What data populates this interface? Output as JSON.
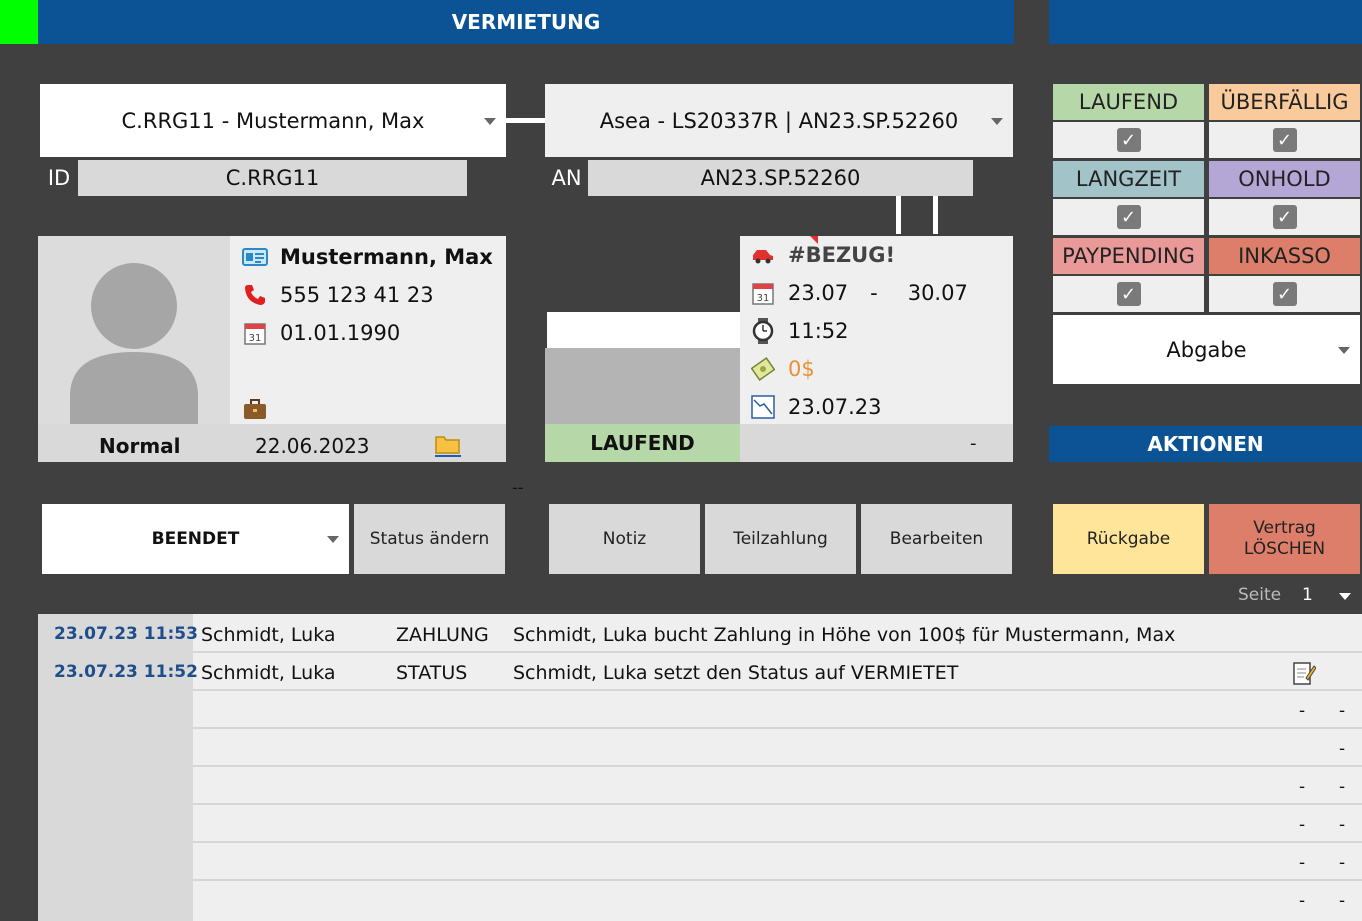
{
  "colors": {
    "header_blue": "#0b5394",
    "green_marker": "#00ff00",
    "laufend": "#b6d7a8",
    "ueberfaellig": "#f9cb9c",
    "langzeit": "#a2c4c9",
    "onhold": "#b4a7d6",
    "paypending": "#ea9999",
    "inkasso": "#dd7e6b",
    "rueckgabe": "#ffe599",
    "loeschen": "#dd7e6b",
    "price_orange": "#e69138"
  },
  "header": {
    "title": "VERMIETUNG"
  },
  "customer": {
    "dropdown": "C.RRG11 - Mustermann, Max",
    "id_label": "ID",
    "id_value": "C.RRG11",
    "name": "Mustermann, Max",
    "phone": "555 123 41 23",
    "birthdate": "01.01.1990",
    "tier": "Normal",
    "since": "22.06.2023",
    "icons": {
      "card": "id-card-icon",
      "phone": "phone-icon",
      "calendar": "calendar-icon",
      "bag": "briefcase-icon",
      "folder": "folder-icon"
    }
  },
  "asset": {
    "dropdown": "Asea - LS20337R | AN23.SP.52260",
    "an_label": "AN",
    "an_value": "AN23.SP.52260",
    "status_badge": "LAUFEND",
    "status_dash": "-",
    "bezug": "#BEZUG!",
    "date_from": "23.07",
    "date_sep": "-",
    "date_to": "30.07",
    "time": "11:52",
    "price": "0$",
    "created": "23.07.23",
    "mid_dash": "--"
  },
  "filters": [
    {
      "label": "LAUFEND",
      "color": "#b6d7a8",
      "checked": true
    },
    {
      "label": "ÜBERFÄLLIG",
      "color": "#f9cb9c",
      "checked": true
    },
    {
      "label": "LANGZEIT",
      "color": "#a2c4c9",
      "checked": true
    },
    {
      "label": "ONHOLD",
      "color": "#b4a7d6",
      "checked": true
    },
    {
      "label": "PAYPENDING",
      "color": "#ea9999",
      "checked": true
    },
    {
      "label": "INKASSO",
      "color": "#dd7e6b",
      "checked": true
    }
  ],
  "abgabe_dropdown": "Abgabe",
  "aktionen": {
    "title": "AKTIONEN"
  },
  "status_dropdown": "BEENDET",
  "buttons": {
    "status_aendern": "Status ändern",
    "notiz": "Notiz",
    "teilzahlung": "Teilzahlung",
    "bearbeiten": "Bearbeiten",
    "rueckgabe": "Rückgabe",
    "loeschen_1": "Vertrag",
    "loeschen_2": "LÖSCHEN"
  },
  "pagination": {
    "label": "Seite",
    "page": "1"
  },
  "log": [
    {
      "time": "23.07.23 11:53",
      "user": "Schmidt, Luka",
      "type": "ZAHLUNG",
      "text": "Schmidt, Luka bucht Zahlung in Höhe von 100$ für Mustermann, Max"
    },
    {
      "time": "23.07.23 11:52",
      "user": "Schmidt, Luka",
      "type": "STATUS",
      "text": "Schmidt, Luka setzt den Status auf VERMIETET"
    }
  ],
  "log_empty": {
    "dash": "-"
  }
}
